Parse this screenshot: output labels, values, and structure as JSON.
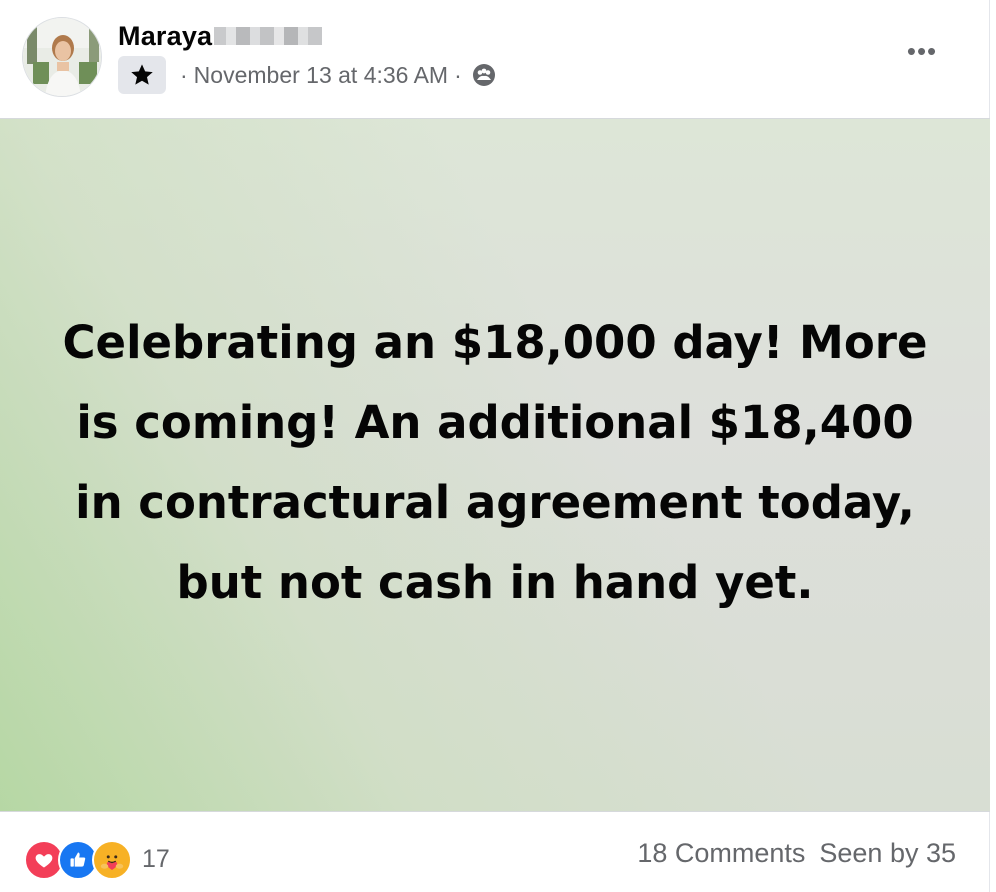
{
  "post": {
    "author": {
      "name": "Maraya"
    },
    "timestamp": "November 13 at 4:36 AM",
    "separator": "·",
    "more_label": "•••",
    "body_text": "Celebrating an $18,000 day! More is coming! An additional $18,400 in contractural agreement today, but not cash in hand yet.",
    "reactions": {
      "types": [
        "love",
        "like",
        "care"
      ],
      "count": "17"
    },
    "comments_label": "18 Comments",
    "seen_label": "Seen by 35"
  },
  "icons": {
    "badge": "star-icon",
    "audience": "group-icon",
    "more": "more-options-icon"
  },
  "colors": {
    "love": "#f33e58",
    "like": "#1877f2",
    "care": "#f7b125",
    "secondary_text": "#65676b"
  }
}
